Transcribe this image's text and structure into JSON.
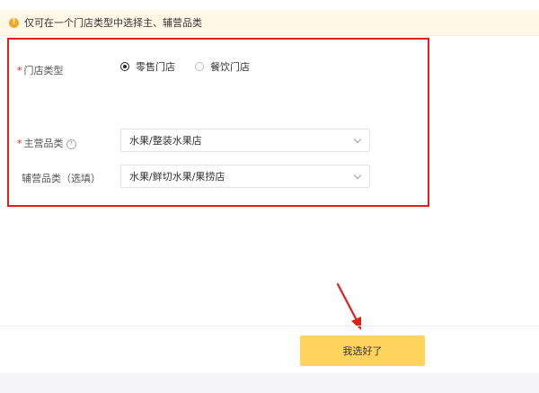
{
  "notice": {
    "icon": "warning-icon",
    "text": "仅可在一个门店类型中选择主、辅营品类",
    "icon_color": "#f5a623"
  },
  "store_type": {
    "label": "门店类型",
    "options": [
      {
        "label": "零售门店",
        "checked": true
      },
      {
        "label": "餐饮门店",
        "checked": false
      }
    ]
  },
  "main_category": {
    "label": "主营品类",
    "help_icon": "question-circle-icon",
    "value": "水果/整装水果店"
  },
  "sub_category": {
    "label": "辅营品类（选填）",
    "value": "水果/鲜切水果/果捞店"
  },
  "confirm_label": "我选好了",
  "colors": {
    "accent": "#ffd35c",
    "highlight": "#e0201b",
    "arrow": "#e0201b"
  }
}
